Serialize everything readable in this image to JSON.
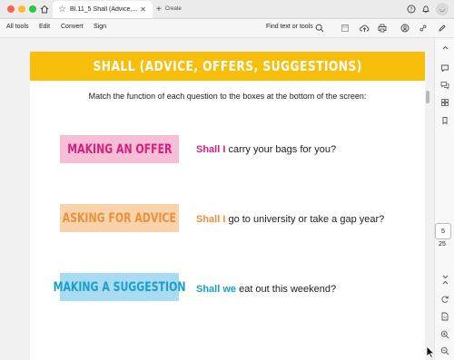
{
  "window": {
    "tab_title": "BI.11_5 Shall (Advice,...",
    "create_label": "Create"
  },
  "menubar": {
    "items": [
      "All tools",
      "Edit",
      "Convert",
      "Sign"
    ],
    "find_label": "Find text or tools"
  },
  "document": {
    "banner_title": "SHALL (ADVICE, OFFERS, SUGGESTIONS)",
    "instruction": "Match the function of each question to the boxes at the bottom of the screen:",
    "rows": [
      {
        "box_label": "MAKING AN OFFER",
        "box_bg": "#f6bfd6",
        "box_fg": "#d81e7e",
        "lead": "Shall I",
        "lead_color": "#d81e7e",
        "rest": " carry your bags for you?"
      },
      {
        "box_label": "ASKING FOR ADVICE",
        "box_bg": "#fbd3ab",
        "box_fg": "#e8913c",
        "lead": "Shall I",
        "lead_color": "#e8913c",
        "rest": " go to university or take a gap year?"
      },
      {
        "box_label": "MAKING A SUGGESTION",
        "box_bg": "#a9dcf2",
        "box_fg": "#1a9fc9",
        "lead": "Shall we",
        "lead_color": "#1a9fc9",
        "rest": " eat out this weekend?"
      }
    ]
  },
  "pager": {
    "current_page": "5",
    "total_pages": "25"
  },
  "colors": {
    "banner": "#f7be0c"
  }
}
